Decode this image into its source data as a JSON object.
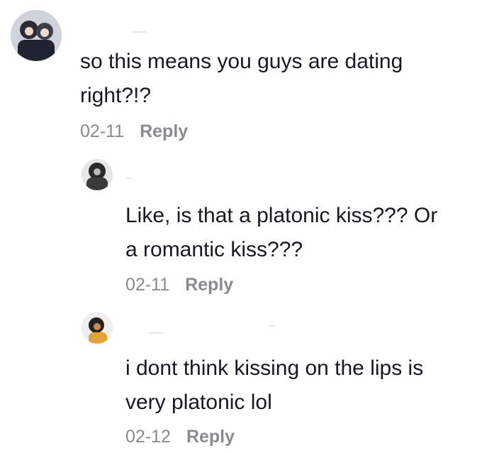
{
  "comments": [
    {
      "avatar_icon": "user-avatar-icon",
      "text": "so this means you guys are dating\nright?!?",
      "date": "02-11",
      "reply_label": "Reply"
    },
    {
      "avatar_icon": "user-avatar-icon",
      "text": "Like, is that a platonic kiss??? Or\na romantic kiss???",
      "date": "02-11",
      "reply_label": "Reply"
    },
    {
      "avatar_icon": "user-avatar-icon",
      "text": "i dont think kissing on the lips is\nvery platonic lol",
      "date": "02-12",
      "reply_label": "Reply"
    }
  ],
  "colors": {
    "text": "#161823",
    "meta": "#8a8b91",
    "background": "#ffffff"
  }
}
